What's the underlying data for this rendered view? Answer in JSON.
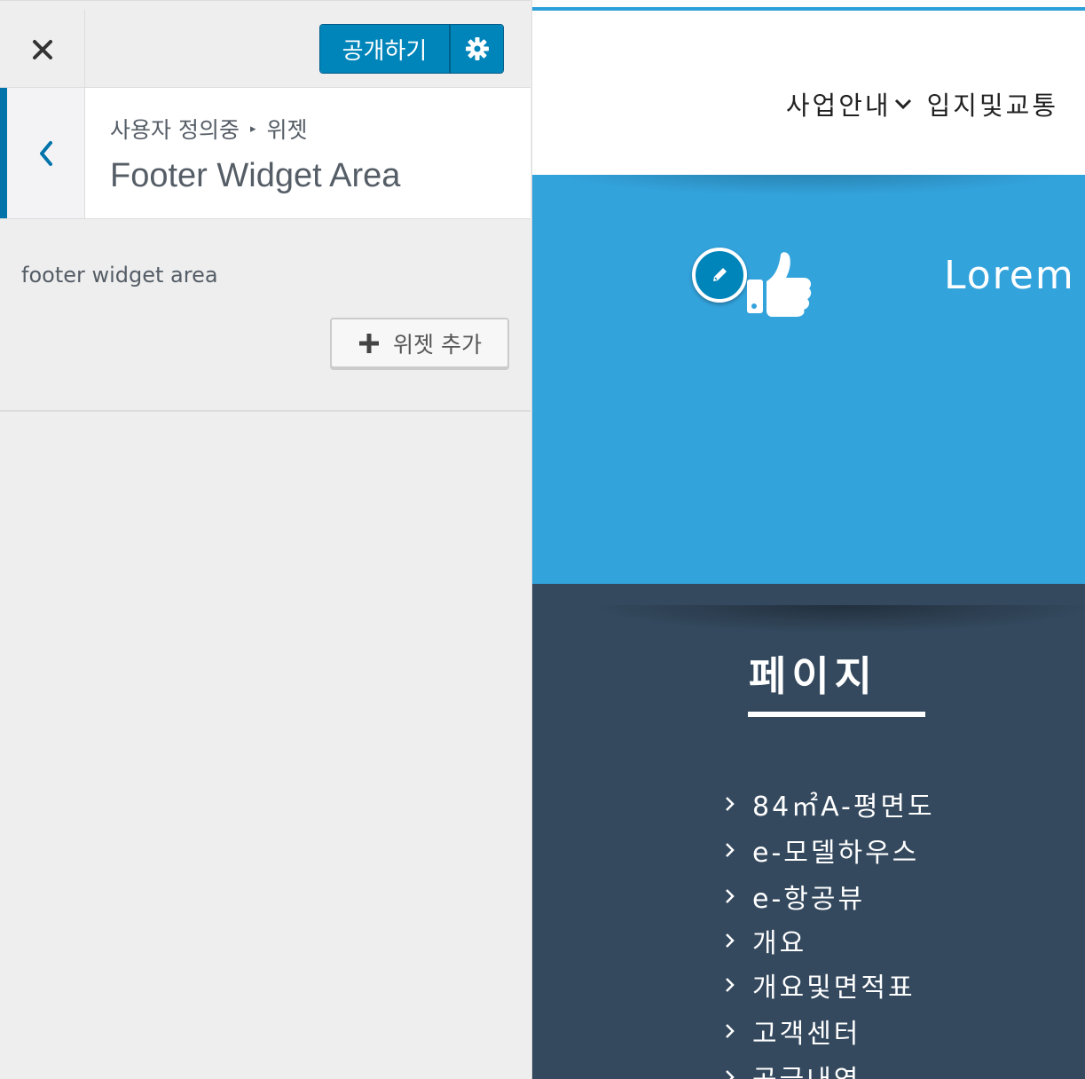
{
  "sidebar": {
    "close_label": "×",
    "publish_label": "공개하기",
    "breadcrumb": {
      "parent": "사용자 정의중",
      "separator": "▸",
      "current": "위젯"
    },
    "section_title": "Footer Widget Area",
    "widget_area_description": "footer widget area",
    "add_widget_label": "위젯 추가",
    "accent_color": "#0085ba"
  },
  "preview": {
    "nav": {
      "items": [
        {
          "label": "사업안내",
          "has_dropdown": true
        },
        {
          "label": "입지및교통",
          "has_dropdown": false
        }
      ]
    },
    "hero": {
      "text": "Lorem I",
      "background_color": "#33a3dc",
      "icon": "thumbs-up-icon"
    },
    "footer": {
      "title": "페이지",
      "background_color": "#34495e",
      "pages": [
        "84㎡A-평면도",
        "e-모델하우스",
        "e-항공뷰",
        "개요",
        "개요및면적표",
        "고객센터",
        "공급내역"
      ]
    }
  }
}
